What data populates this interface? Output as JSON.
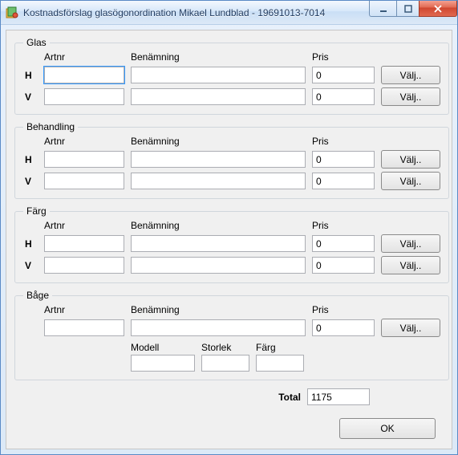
{
  "window": {
    "title": "Kostnadsförslag glasögonordination Mikael Lundblad - 19691013-7014"
  },
  "labels": {
    "artnr": "Artnr",
    "benamning": "Benämning",
    "pris": "Pris",
    "valj": "Välj..",
    "modell": "Modell",
    "storlek": "Storlek",
    "farg": "Färg",
    "total": "Total",
    "ok": "OK",
    "H": "H",
    "V": "V"
  },
  "groups": {
    "glas": {
      "legend": "Glas",
      "rows": [
        {
          "eye": "H",
          "artnr": "",
          "benamning": "",
          "pris": "0"
        },
        {
          "eye": "V",
          "artnr": "",
          "benamning": "",
          "pris": "0"
        }
      ]
    },
    "behandling": {
      "legend": "Behandling",
      "rows": [
        {
          "eye": "H",
          "artnr": "",
          "benamning": "",
          "pris": "0"
        },
        {
          "eye": "V",
          "artnr": "",
          "benamning": "",
          "pris": "0"
        }
      ]
    },
    "farg": {
      "legend": "Färg",
      "rows": [
        {
          "eye": "H",
          "artnr": "",
          "benamning": "",
          "pris": "0"
        },
        {
          "eye": "V",
          "artnr": "",
          "benamning": "",
          "pris": "0"
        }
      ]
    },
    "bage": {
      "legend": "Båge",
      "artnr": "",
      "benamning": "",
      "pris": "0",
      "modell": "",
      "storlek": "",
      "farg": ""
    }
  },
  "total": "1175"
}
